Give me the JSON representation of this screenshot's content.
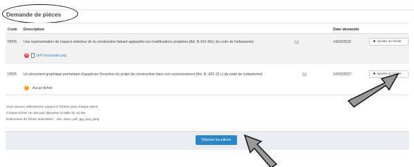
{
  "panel": {
    "title": "Demande de pièces"
  },
  "table": {
    "headers": {
      "code": "Code",
      "description": "Description",
      "date": "Date demande"
    },
    "rows": [
      {
        "code": "DP05",
        "description": "Une représentation de l'aspect extérieur de la construction faisant apparaître les modifications projetées [Art. R.431-36c) du code de l'urbanisme]",
        "date": "14/03/2022",
        "button": "Ajouter un fichier",
        "file": {
          "name": "2647-incomplet.png",
          "status_icon": "error-icon",
          "type_icon": "file-icon"
        }
      },
      {
        "code": "DP06",
        "description": "Un document graphique permettant d'apprécier l'insertion du projet de construction dans son environnement [Art. R. 431-10 c) du code de l'urbanisme]",
        "date": "14/03/2022",
        "button": "Ajouter un fichier",
        "file": {
          "name": "Aucun fichier",
          "status_icon": "warning-icon"
        }
      }
    ]
  },
  "info_lines": [
    "Vous pouvez sélectionner jusqu'à 8 fichiers pour chaque pièce.",
    "Chaque fichier ne doit pas dépasser la taille de 10 Mo.",
    "Extensions de fichier autorisées : .doc,.docx,.pdf,.jpg,.png,.jpeg"
  ],
  "footer": {
    "submit_label": "Déposer les pièces"
  },
  "colors": {
    "primary": "#2b86c5",
    "error": "#e24a4a",
    "warning": "#f0a020",
    "link": "#3d7ec9"
  }
}
